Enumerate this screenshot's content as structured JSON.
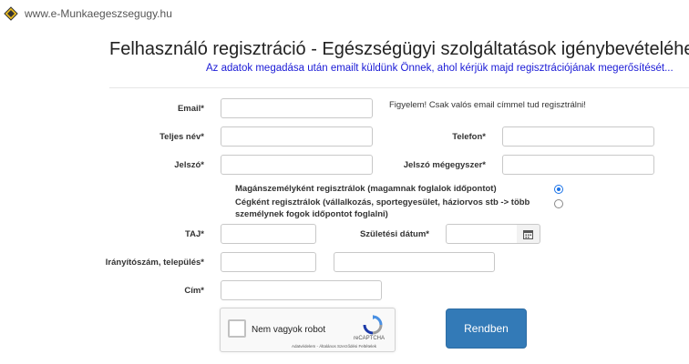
{
  "header": {
    "site_url": "www.e-Munkaegeszsegugy.hu",
    "logo_icon": "diamond-logo-icon"
  },
  "page": {
    "title": "Felhasználó regisztráció - Egészségügyi szolgáltatások igénybevételéhez",
    "subtitle": "Az adatok megadása után emailt küldünk Önnek, ahol kérjük majd regisztrációjának megerősítését..."
  },
  "form": {
    "email_label": "Email*",
    "email_note": "Figyelem! Csak valós email címmel tud regisztrálni!",
    "fullname_label": "Teljes név*",
    "phone_label": "Telefon*",
    "password_label": "Jelszó*",
    "password_confirm_label": "Jelszó mégegyszer*",
    "radio_private_label": "Magánszemélyként regisztrálok (magamnak foglalok időpontot)",
    "radio_company_label": "Cégként regisztrálok (vállalkozás, sportegyesület, háziorvos stb -> több személynek fogok időpontot foglalni)",
    "selected_option": "private",
    "taj_label": "TAJ*",
    "birthdate_label": "Születési dátum*",
    "zip_city_label": "Irányítószám, település*",
    "address_label": "Cím*",
    "submit_label": "Rendben"
  },
  "captcha": {
    "label": "Nem vagyok robot",
    "brand": "reCAPTCHA",
    "legal": "Adatvédelem - Általános Szerződési Feltételek"
  },
  "colors": {
    "title_text": "#222222",
    "subtitle_text": "#1a1ad6",
    "submit_button": "#337ab7",
    "radio_accent": "#1a73e8"
  }
}
